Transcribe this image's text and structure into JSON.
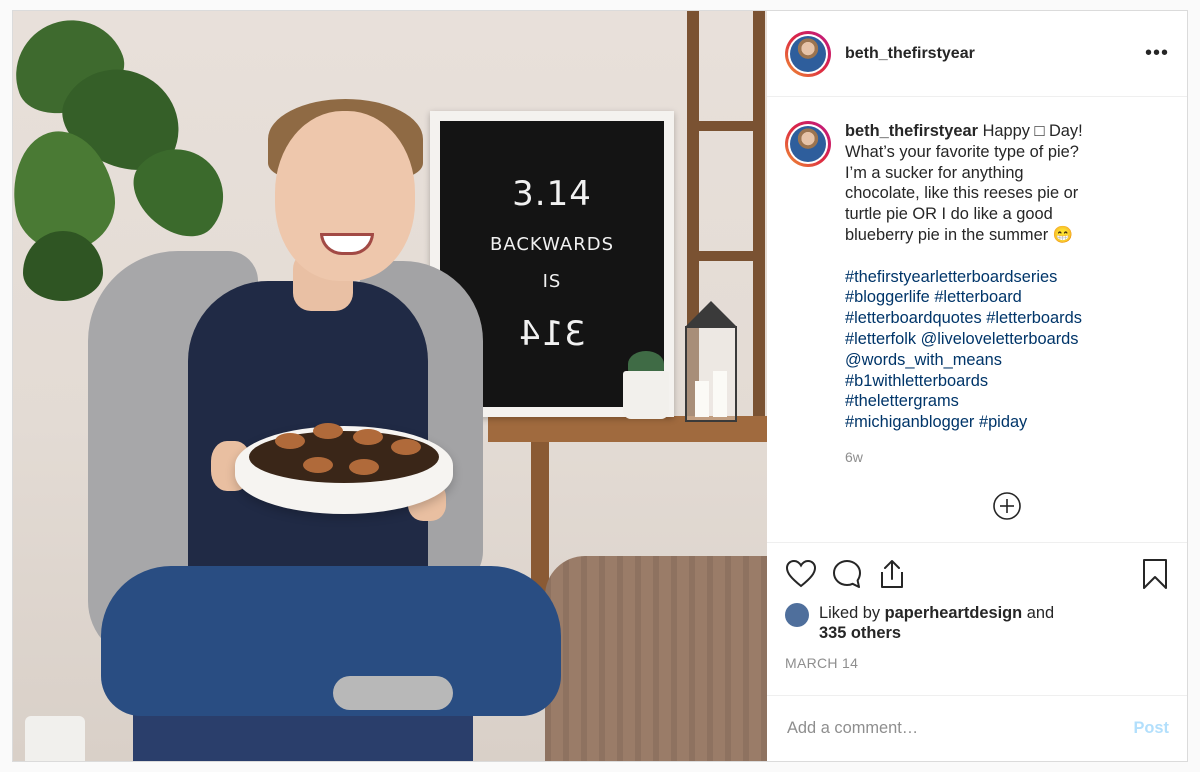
{
  "post": {
    "username": "beth_thefirstyear",
    "more_label": "•••",
    "letterboard": {
      "line1": "3.14",
      "line2": "BACKWARDS",
      "line3": "IS",
      "line4": "314"
    },
    "caption": {
      "username": "beth_thefirstyear",
      "lines": [
        "Happy □ Day!",
        "What’s your favorite type of pie?",
        "I’m a sucker for anything",
        "chocolate, like this reeses pie or",
        "turtle pie OR I do like a good",
        "blueberry pie in the summer 😁"
      ],
      "hashtags": [
        "#thefirstyearletterboardseries",
        "#bloggerlife",
        "#letterboard",
        "#letterboardquotes",
        "#letterboards",
        "#letterfolk",
        "@liveloveletterboards",
        "@words_with_means",
        "#b1withletterboards",
        "#thelettergrams",
        "#michiganblogger",
        "#piday"
      ],
      "age": "6w"
    },
    "likes": {
      "prefix": "Liked by",
      "user": "paperheartdesign",
      "suffix": "and",
      "others": "335 others"
    },
    "date": "MARCH 14",
    "comment": {
      "placeholder": "Add a comment…",
      "post_label": "Post"
    },
    "icons": [
      "heart-icon",
      "comment-icon",
      "share-icon",
      "bookmark-icon",
      "plus-circle-icon"
    ],
    "colors": {
      "hashtag": "#003569",
      "muted": "#8e8e8e",
      "post_button": "#b2dffc"
    }
  }
}
